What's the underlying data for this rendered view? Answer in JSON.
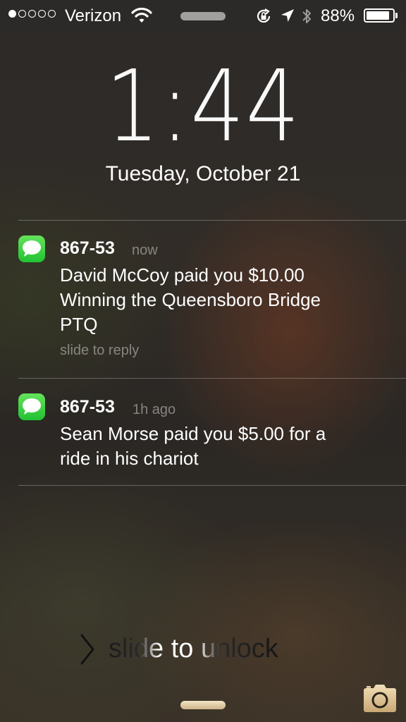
{
  "status_bar": {
    "signal_bars": 1,
    "signal_total": 5,
    "carrier": "Verizon",
    "wifi_icon": "wifi-icon",
    "rotation_lock_icon": "rotation-lock-icon",
    "location_icon": "location-arrow-icon",
    "bluetooth_icon": "bluetooth-icon",
    "battery_percent": "88%",
    "battery_level": 0.88
  },
  "lock_screen": {
    "time": "1:44",
    "date": "Tuesday, October 21"
  },
  "notifications": [
    {
      "app_icon": "messages-icon",
      "sender": "867-53",
      "time": "now",
      "body_lines": [
        "David McCoy paid you $10.00",
        "Winning the Queensboro Bridge",
        "PTQ"
      ],
      "action": "slide to reply"
    },
    {
      "app_icon": "messages-icon",
      "sender": "867-53",
      "time": "1h ago",
      "body_lines": [
        "Sean Morse paid you $5.00 for a",
        "ride in his chariot"
      ]
    }
  ],
  "unlock": {
    "label": "slide to unlock",
    "chevron_icon": "chevron-right-icon",
    "camera_icon": "camera-icon"
  },
  "colors": {
    "messages_green": "#21c233",
    "secondary_text": "#8a8a86"
  }
}
